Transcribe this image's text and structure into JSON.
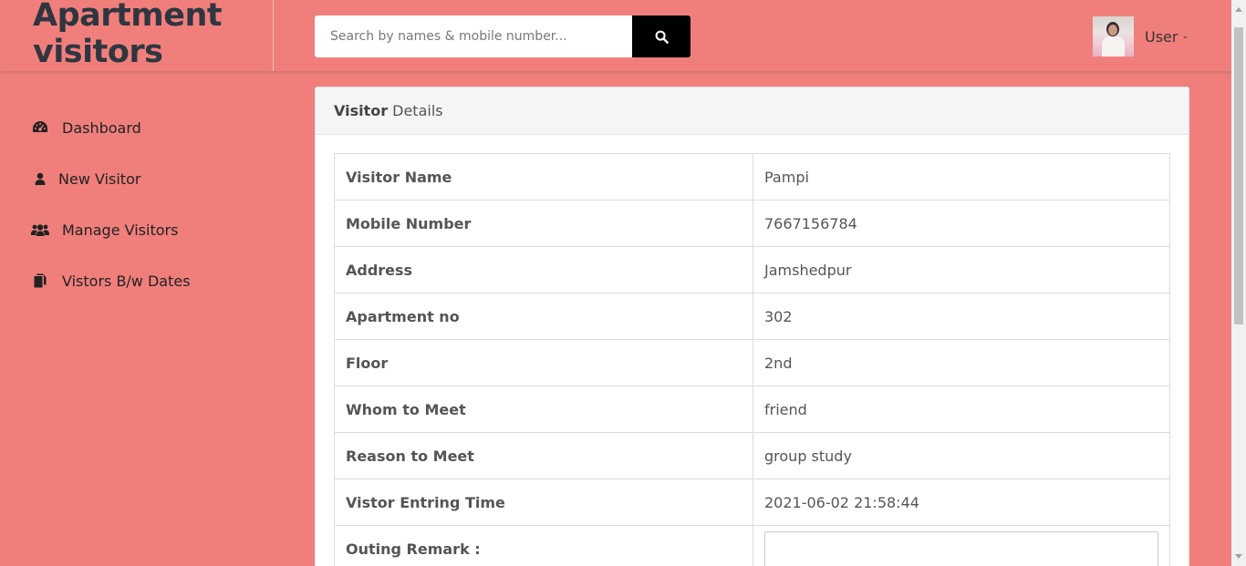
{
  "brand": {
    "line1": "Apartment",
    "line2": "visitors"
  },
  "search": {
    "placeholder": "Search by names & mobile number...",
    "button_icon": "search-icon"
  },
  "user": {
    "label": "User"
  },
  "sidebar": {
    "items": [
      {
        "label": "Dashboard",
        "icon": "dashboard-icon"
      },
      {
        "label": "New Visitor",
        "icon": "user-icon"
      },
      {
        "label": "Manage Visitors",
        "icon": "users-icon"
      },
      {
        "label": "Vistors B/w Dates",
        "icon": "copy-icon"
      }
    ]
  },
  "panel": {
    "title_bold": "Visitor",
    "title_rest": "Details",
    "rows": [
      {
        "label": "Visitor Name",
        "value": "Pampi"
      },
      {
        "label": "Mobile Number",
        "value": "7667156784"
      },
      {
        "label": "Address",
        "value": "Jamshedpur"
      },
      {
        "label": "Apartment no",
        "value": "302"
      },
      {
        "label": "Floor",
        "value": "2nd"
      },
      {
        "label": "Whom to Meet",
        "value": "friend"
      },
      {
        "label": "Reason to Meet",
        "value": "group study"
      },
      {
        "label": "Vistor Entring Time",
        "value": "2021-06-02 21:58:44"
      }
    ],
    "remark_label": "Outing Remark :"
  },
  "colors": {
    "background": "#f07f7c",
    "search_button": "#000000"
  }
}
